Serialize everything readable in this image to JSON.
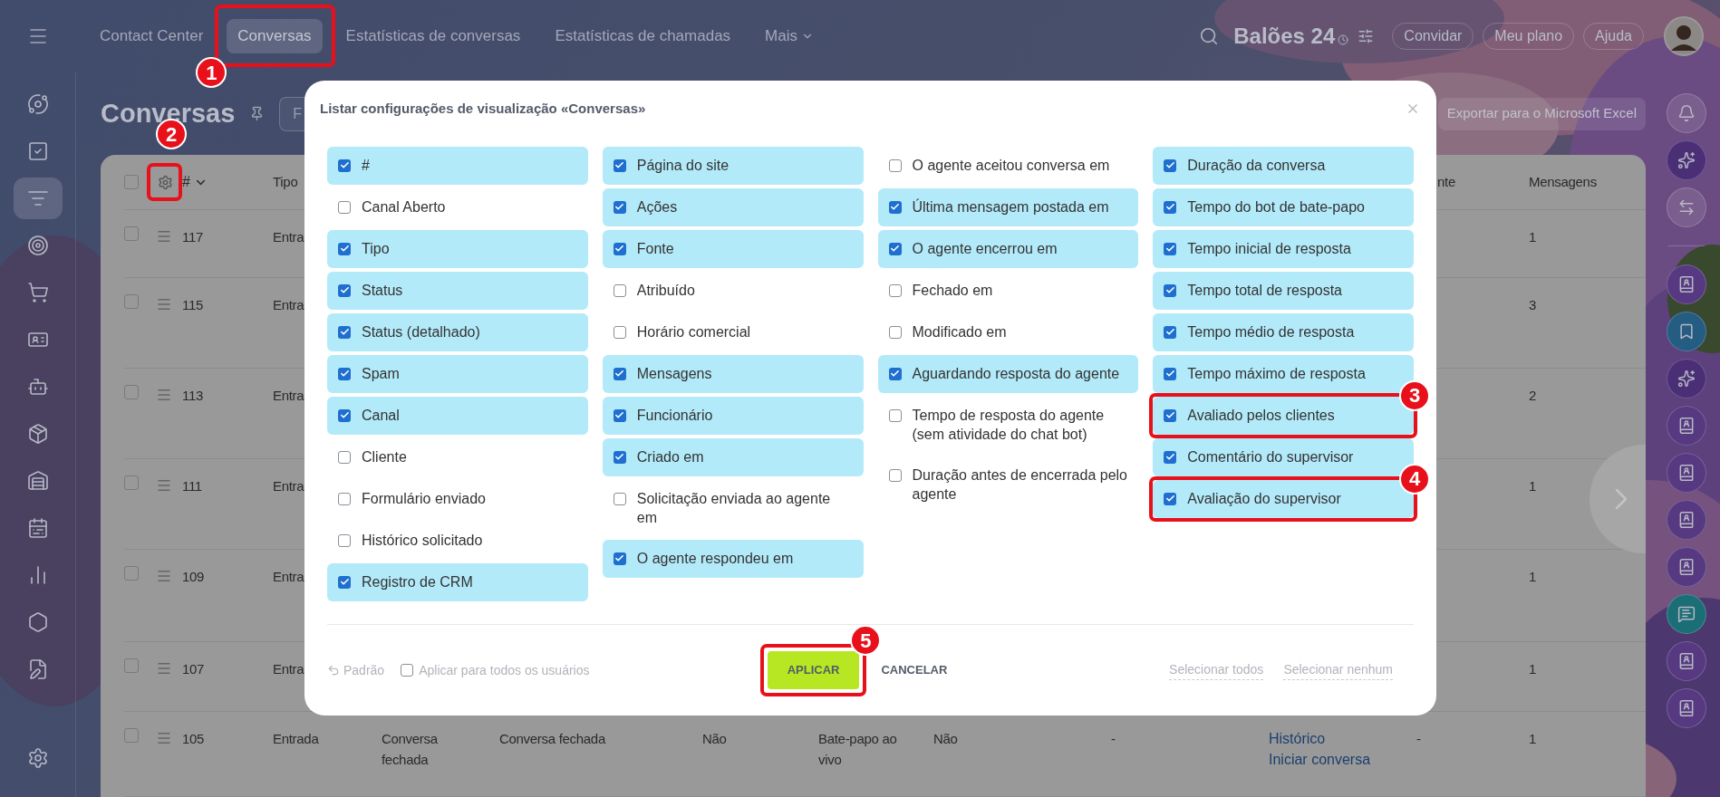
{
  "topbar": {
    "tabs": [
      {
        "label": "Contact Center",
        "selected": false
      },
      {
        "label": "Conversas",
        "selected": true,
        "callout": "1"
      },
      {
        "label": "Estatísticas de conversas",
        "selected": false
      },
      {
        "label": "Estatísticas de chamadas",
        "selected": false
      },
      {
        "label": "Mais",
        "selected": false,
        "kind": "menu"
      }
    ],
    "brand": "Balões 24",
    "buttons": [
      "Convidar",
      "Meu plano",
      "Ajuda"
    ]
  },
  "sidebar": {
    "items": [
      {
        "kind": "orbit",
        "selected": false
      },
      {
        "kind": "tasks",
        "selected": false
      },
      {
        "kind": "funnel",
        "selected": true
      },
      {
        "kind": "target",
        "selected": false
      },
      {
        "kind": "cart",
        "selected": false
      },
      {
        "kind": "card",
        "selected": false
      },
      {
        "kind": "bot",
        "selected": false
      },
      {
        "kind": "package",
        "selected": false
      },
      {
        "kind": "warehouse",
        "selected": false
      },
      {
        "kind": "calendar",
        "selected": false
      },
      {
        "kind": "chart",
        "selected": false
      },
      {
        "kind": "hexagon",
        "selected": false
      },
      {
        "kind": "document",
        "selected": false
      }
    ],
    "bottom": {
      "kind": "settings",
      "selected": false
    }
  },
  "rail": {
    "top": [
      {
        "kind": "bell"
      },
      {
        "kind": "ai"
      },
      {
        "kind": "swap"
      }
    ],
    "chats": [
      {
        "kind": "contact"
      },
      {
        "kind": "bookmark"
      },
      {
        "kind": "ai"
      },
      {
        "kind": "contact"
      },
      {
        "kind": "contact"
      },
      {
        "kind": "contact"
      },
      {
        "kind": "contact"
      },
      {
        "kind": "chat"
      },
      {
        "kind": "contact"
      },
      {
        "kind": "contact"
      }
    ]
  },
  "page": {
    "title": "Conversas",
    "filter": {
      "placeholder": "F"
    },
    "export": "Exportar para o Microsoft Excel"
  },
  "table": {
    "settings_callout": "2",
    "select_all": {
      "checked": false
    },
    "columns": {
      "id": "#",
      "tipo": "Tipo",
      "column_12": "nte",
      "mensagens": "Mensagens"
    },
    "rows": [
      {
        "checked": false,
        "id": "117",
        "tipo": "Entra",
        "mensagens": "1"
      },
      {
        "checked": false,
        "id": "115",
        "tipo": "Entra",
        "mensagens": "3"
      },
      {
        "checked": false,
        "id": "113",
        "tipo": "Entra",
        "mensagens": "2"
      },
      {
        "checked": false,
        "id": "111",
        "tipo": "Entra",
        "mensagens": "1"
      },
      {
        "checked": false,
        "id": "109",
        "tipo": "Entra",
        "mensagens": "1"
      },
      {
        "checked": false,
        "id": "107",
        "tipo": "Entra",
        "mensagens": "1"
      },
      {
        "checked": false,
        "id": "105",
        "tipo": "Entrada",
        "column_5": "Conversa fechada",
        "column_6": "Conversa fechada",
        "column_7": "Não",
        "column_8": "Bate-papo ao vivo",
        "column_9": "Não",
        "column_10": "-",
        "column_11": [
          "Histórico",
          "Iniciar conversa"
        ],
        "column_12": "-",
        "mensagens": "1"
      }
    ]
  },
  "modal": {
    "title": "Listar configurações de visualização «Conversas»",
    "columns": [
      [
        {
          "label": "#",
          "checked": true
        },
        {
          "label": "Canal Aberto",
          "checked": false
        },
        {
          "label": "Tipo",
          "checked": true
        },
        {
          "label": "Status",
          "checked": true
        },
        {
          "label": "Status (detalhado)",
          "checked": true
        },
        {
          "label": "Spam",
          "checked": true
        },
        {
          "label": "Canal",
          "checked": true
        },
        {
          "label": "Cliente",
          "checked": false
        },
        {
          "label": "Formulário enviado",
          "checked": false
        },
        {
          "label": "Histórico solicitado",
          "checked": false
        },
        {
          "label": "Registro de CRM",
          "checked": true
        }
      ],
      [
        {
          "label": "Página do site",
          "checked": true
        },
        {
          "label": "Ações",
          "checked": true
        },
        {
          "label": "Fonte",
          "checked": true
        },
        {
          "label": "Atribuído",
          "checked": false
        },
        {
          "label": "Horário comercial",
          "checked": false
        },
        {
          "label": "Mensagens",
          "checked": true
        },
        {
          "label": "Funcionário",
          "checked": true
        },
        {
          "label": "Criado em",
          "checked": true
        },
        {
          "label": "Solicitação enviada ao agente em",
          "checked": false
        },
        {
          "label": "O agente respondeu em",
          "checked": true
        }
      ],
      [
        {
          "label": "O agente aceitou conversa em",
          "checked": false
        },
        {
          "label": "Última mensagem postada em",
          "checked": true
        },
        {
          "label": "O agente encerrou em",
          "checked": true
        },
        {
          "label": "Fechado em",
          "checked": false
        },
        {
          "label": "Modificado em",
          "checked": false
        },
        {
          "label": "Aguardando resposta do agente",
          "checked": true
        },
        {
          "label": "Tempo de resposta do agente (sem atividade do chat bot)",
          "checked": false
        },
        {
          "label": "Duração antes de encerrada pelo agente",
          "checked": false
        }
      ],
      [
        {
          "label": "Duração da conversa",
          "checked": true
        },
        {
          "label": "Tempo do bot de bate-papo",
          "checked": true
        },
        {
          "label": "Tempo inicial de resposta",
          "checked": true
        },
        {
          "label": "Tempo total de resposta",
          "checked": true
        },
        {
          "label": "Tempo médio de resposta",
          "checked": true
        },
        {
          "label": "Tempo máximo de resposta",
          "checked": true
        },
        {
          "label": "Avaliado pelos clientes",
          "checked": true,
          "callout": "3"
        },
        {
          "label": "Comentário do supervisor",
          "checked": true
        },
        {
          "label": "Avaliação do supervisor",
          "checked": true,
          "callout": "4"
        }
      ]
    ],
    "footer": {
      "reset": "Padrão",
      "apply_all": {
        "label": "Aplicar para todos os usuários",
        "checked": false
      },
      "apply": "APLICAR",
      "apply_callout": "5",
      "cancel": "CANCELAR",
      "select_all": "Selecionar todos",
      "select_none": "Selecionar nenhum"
    }
  }
}
